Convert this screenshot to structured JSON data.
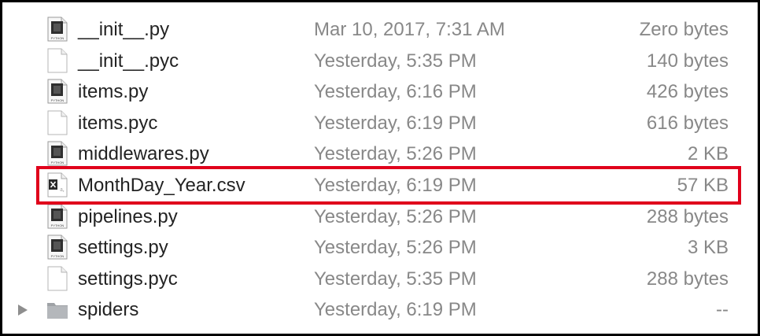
{
  "files": [
    {
      "name": "__init__.py",
      "date": "Mar 10, 2017, 7:31 AM",
      "size": "Zero bytes",
      "icon": "python-file-icon",
      "icon_caption": "PYTHON"
    },
    {
      "name": "__init__.pyc",
      "date": "Yesterday, 5:35 PM",
      "size": "140 bytes",
      "icon": "generic-file-icon"
    },
    {
      "name": "items.py",
      "date": "Yesterday, 6:16 PM",
      "size": "426 bytes",
      "icon": "python-file-icon",
      "icon_caption": "PYTHON"
    },
    {
      "name": "items.pyc",
      "date": "Yesterday, 6:19 PM",
      "size": "616 bytes",
      "icon": "generic-file-icon"
    },
    {
      "name": "middlewares.py",
      "date": "Yesterday, 5:26 PM",
      "size": "2 KB",
      "icon": "python-file-icon",
      "icon_caption": "PYTHON"
    },
    {
      "name": "MonthDay_Year.csv",
      "date": "Yesterday, 6:19 PM",
      "size": "57 KB",
      "icon": "excel-csv-file-icon",
      "highlighted": true
    },
    {
      "name": "pipelines.py",
      "date": "Yesterday, 5:26 PM",
      "size": "288 bytes",
      "icon": "python-file-icon",
      "icon_caption": "PYTHON"
    },
    {
      "name": "settings.py",
      "date": "Yesterday, 5:26 PM",
      "size": "3 KB",
      "icon": "python-file-icon",
      "icon_caption": "PYTHON"
    },
    {
      "name": "settings.pyc",
      "date": "Yesterday, 5:35 PM",
      "size": "288 bytes",
      "icon": "generic-file-icon"
    },
    {
      "name": "spiders",
      "date": "Yesterday, 6:19 PM",
      "size": "--",
      "icon": "folder-icon",
      "collapsed": true
    }
  ],
  "colors": {
    "name_text": "#232323",
    "secondary_text": "#888888",
    "highlight_border": "#e0001b",
    "frame_border": "#000000"
  }
}
